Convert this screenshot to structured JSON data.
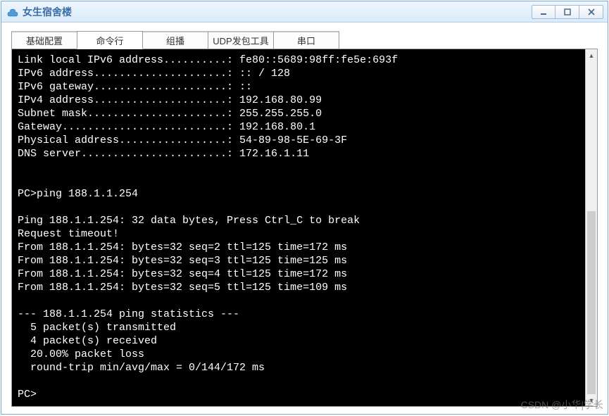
{
  "window": {
    "title": "女生宿舍楼",
    "min_label": "Minimize",
    "max_label": "Maximize",
    "close_label": "Close"
  },
  "tabs": [
    {
      "label": "基础配置",
      "active": false
    },
    {
      "label": "命令行",
      "active": true
    },
    {
      "label": "组播",
      "active": false
    },
    {
      "label": "UDP发包工具",
      "active": false
    },
    {
      "label": "串口",
      "active": false
    }
  ],
  "terminal": {
    "lines": [
      "Link local IPv6 address..........: fe80::5689:98ff:fe5e:693f",
      "IPv6 address.....................: :: / 128",
      "IPv6 gateway.....................: ::",
      "IPv4 address.....................: 192.168.80.99",
      "Subnet mask......................: 255.255.255.0",
      "Gateway..........................: 192.168.80.1",
      "Physical address.................: 54-89-98-5E-69-3F",
      "DNS server.......................: 172.16.1.11",
      "",
      "",
      "PC>ping 188.1.1.254",
      "",
      "Ping 188.1.1.254: 32 data bytes, Press Ctrl_C to break",
      "Request timeout!",
      "From 188.1.1.254: bytes=32 seq=2 ttl=125 time=172 ms",
      "From 188.1.1.254: bytes=32 seq=3 ttl=125 time=125 ms",
      "From 188.1.1.254: bytes=32 seq=4 ttl=125 time=172 ms",
      "From 188.1.1.254: bytes=32 seq=5 ttl=125 time=109 ms",
      "",
      "--- 188.1.1.254 ping statistics ---",
      "  5 packet(s) transmitted",
      "  4 packet(s) received",
      "  20.00% packet loss",
      "  round-trip min/avg/max = 0/144/172 ms",
      "",
      "PC>"
    ]
  },
  "watermark": "CSDN @小华|学长"
}
